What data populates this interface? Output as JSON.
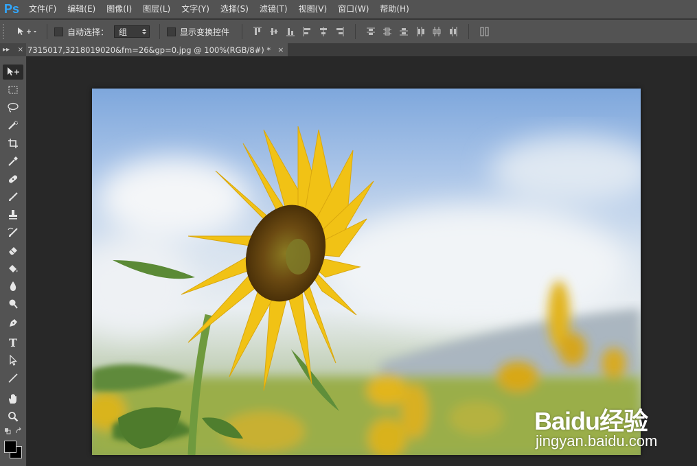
{
  "app": {
    "logo": "Ps",
    "brand_color": "#31a8ff"
  },
  "menu": [
    "文件(F)",
    "编辑(E)",
    "图像(I)",
    "图层(L)",
    "文字(Y)",
    "选择(S)",
    "滤镜(T)",
    "视图(V)",
    "窗口(W)",
    "帮助(H)"
  ],
  "options": {
    "auto_select_label": "自动选择：",
    "auto_select_checked": false,
    "auto_select_mode": "组",
    "show_transform_label": "显示变换控件",
    "show_transform_checked": false
  },
  "panel_head": {
    "expand": "▸▸",
    "close": "×"
  },
  "document": {
    "tab_title": "7315017,3218019020&fm=26&gp=0.jpg @ 100%(RGB/8#) *",
    "close_icon": "×"
  },
  "tools": [
    "move-tool",
    "rectangular-marquee-tool",
    "lasso-tool",
    "quick-selection-tool",
    "crop-tool",
    "eyedropper-tool",
    "spot-healing-brush-tool",
    "brush-tool",
    "clone-stamp-tool",
    "history-brush-tool",
    "eraser-tool",
    "paint-bucket-tool",
    "blur-tool",
    "dodge-tool",
    "pen-tool",
    "type-tool",
    "path-selection-tool",
    "line-tool",
    "hand-tool",
    "zoom-tool"
  ],
  "type_tool_glyph": "T",
  "colors": {
    "foreground": "#000000",
    "background": "#000000"
  },
  "watermark": {
    "logo": "Baidu经验",
    "url": "jingyan.baidu.com"
  }
}
